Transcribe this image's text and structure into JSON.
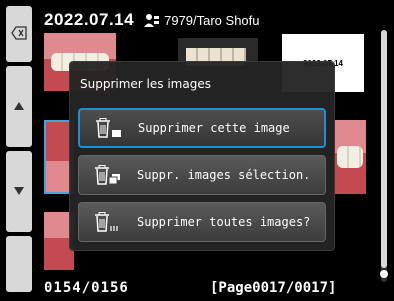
{
  "header": {
    "date": "2022.07.14",
    "patient": "7979/Taro Shofu"
  },
  "thumbnail_label": "2022.07.14",
  "side": {
    "icons": [
      "backspace-icon",
      "up-arrow-icon",
      "down-arrow-icon"
    ]
  },
  "dialog": {
    "title": "Supprimer les images",
    "buttons": [
      {
        "label": "Supprimer cette image",
        "icon": "trash-single-icon"
      },
      {
        "label": "Suppr. images sélection.",
        "icon": "trash-selected-icon"
      },
      {
        "label": "Supprimer toutes images?",
        "icon": "trash-all-icon"
      }
    ]
  },
  "footer": {
    "count": "0154/0156",
    "page": "[Page0017/0017]"
  },
  "colors": {
    "accent": "#1e8fd0",
    "background": "#000000"
  }
}
